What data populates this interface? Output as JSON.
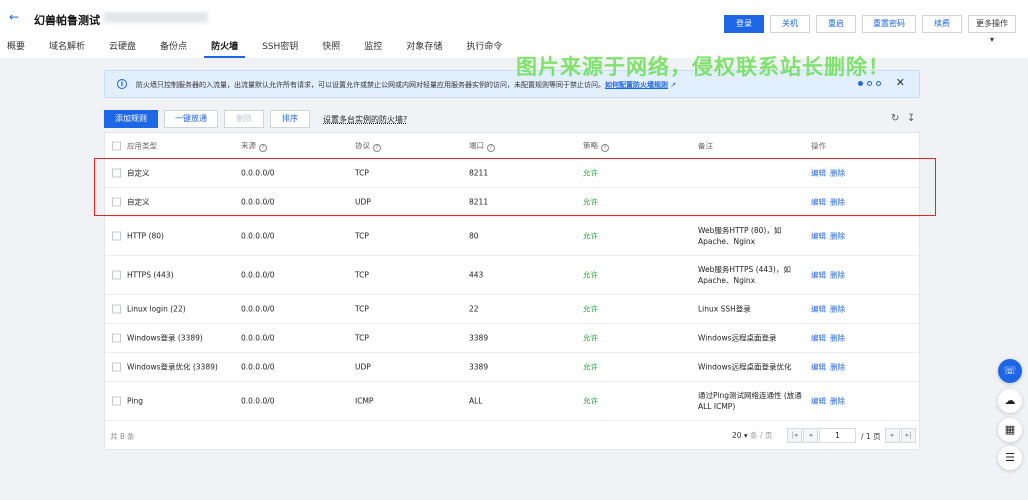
{
  "header": {
    "back_icon": "arrow-left-icon",
    "title": "幻兽帕鲁测试",
    "actions": [
      "登录",
      "关机",
      "重启",
      "重置密码",
      "续费",
      "更多操作 ▾"
    ]
  },
  "tabs": [
    {
      "label": "概要",
      "active": false
    },
    {
      "label": "域名解析",
      "active": false
    },
    {
      "label": "云硬盘",
      "active": false
    },
    {
      "label": "备份点",
      "active": false
    },
    {
      "label": "防火墙",
      "active": true
    },
    {
      "label": "SSH密钥",
      "active": false
    },
    {
      "label": "快照",
      "active": false
    },
    {
      "label": "监控",
      "active": false
    },
    {
      "label": "对象存储",
      "active": false
    },
    {
      "label": "执行命令",
      "active": false
    }
  ],
  "watermark": "图片来源于网络，侵权联系站长删除！",
  "notice": {
    "text": "防火墙只控制服务器的入流量，出流量默认允许所有请求，可以设置允许或禁止公网或内网对轻量应用服务器实例的访问，未配置规则等同于禁止访问。",
    "link": "如何配置防火墙规则",
    "close": "✕"
  },
  "toolbar": {
    "add": "添加规则",
    "quick": "一键放通",
    "delete": "删除",
    "sort": "排序",
    "multi_link": "设置多台实例的防火墙?"
  },
  "table": {
    "headers": {
      "app_type": "应用类型",
      "source": "来源",
      "protocol": "协议",
      "port": "端口",
      "policy": "策略",
      "note": "备注",
      "ops": "操作"
    },
    "rows": [
      {
        "app_type": "自定义",
        "source": "0.0.0.0/0",
        "protocol": "TCP",
        "port": "8211",
        "policy": "允许",
        "note": "",
        "edit": "编辑",
        "delete": "删除"
      },
      {
        "app_type": "自定义",
        "source": "0.0.0.0/0",
        "protocol": "UDP",
        "port": "8211",
        "policy": "允许",
        "note": "",
        "edit": "编辑",
        "delete": "删除"
      },
      {
        "app_type": "HTTP (80)",
        "source": "0.0.0.0/0",
        "protocol": "TCP",
        "port": "80",
        "policy": "允许",
        "note": "Web服务HTTP (80)，如 Apache、Nginx",
        "edit": "编辑",
        "delete": "删除"
      },
      {
        "app_type": "HTTPS (443)",
        "source": "0.0.0.0/0",
        "protocol": "TCP",
        "port": "443",
        "policy": "允许",
        "note": "Web服务HTTPS (443)，如 Apache、Nginx",
        "edit": "编辑",
        "delete": "删除"
      },
      {
        "app_type": "Linux login (22)",
        "source": "0.0.0.0/0",
        "protocol": "TCP",
        "port": "22",
        "policy": "允许",
        "note": "Linux SSH登录",
        "edit": "编辑",
        "delete": "删除"
      },
      {
        "app_type": "Windows登录 (3389)",
        "source": "0.0.0.0/0",
        "protocol": "TCP",
        "port": "3389",
        "policy": "允许",
        "note": "Windows远程桌面登录",
        "edit": "编辑",
        "delete": "删除"
      },
      {
        "app_type": "Windows登录优化 (3389)",
        "source": "0.0.0.0/0",
        "protocol": "UDP",
        "port": "3389",
        "policy": "允许",
        "note": "Windows远程桌面登录优化",
        "edit": "编辑",
        "delete": "删除"
      },
      {
        "app_type": "Ping",
        "source": "0.0.0.0/0",
        "protocol": "ICMP",
        "port": "ALL",
        "policy": "允许",
        "note": "通过Ping测试网络连通性 (放通ALL ICMP)",
        "edit": "编辑",
        "delete": "删除"
      }
    ]
  },
  "pagination": {
    "total": "共 8 条",
    "page_size": "20 ▾",
    "page_size_unit": "条 / 页",
    "current_page": "1",
    "total_pages": "/ 1 页"
  },
  "float_buttons": [
    "headset-icon",
    "cloud-icon",
    "book-icon",
    "list-icon"
  ],
  "colors": {
    "accent": "#1d66e6",
    "allow": "#23a53a",
    "highlight": "#e0252c"
  }
}
